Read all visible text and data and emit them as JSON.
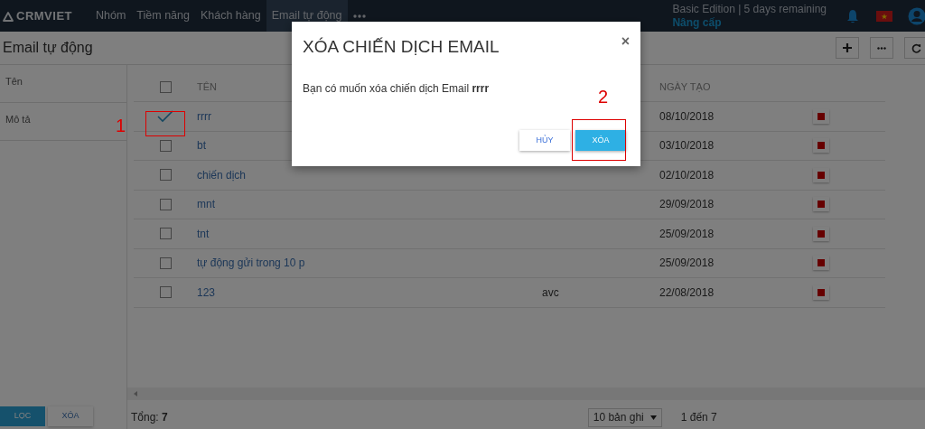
{
  "navbar": {
    "logo": "CRMVIET",
    "menu": [
      {
        "label": "Nhóm",
        "selected": false
      },
      {
        "label": "Tiềm năng",
        "selected": false
      },
      {
        "label": "Khách hàng",
        "selected": false
      },
      {
        "label": "Email tự động",
        "selected": true
      }
    ],
    "edition": "Basic Edition | 5 days remaining",
    "upgrade": "Nâng cấp"
  },
  "page": {
    "title": "Email tự động"
  },
  "filters": [
    {
      "label": "Tên"
    },
    {
      "label": "Mô tả"
    }
  ],
  "filter_buttons": [
    {
      "label": "LỌC",
      "kind": "primary"
    },
    {
      "label": "XÓA",
      "kind": "secondary"
    }
  ],
  "table": {
    "header_checked": false,
    "columns": [
      "TÊN",
      "NGÀY TẠO"
    ],
    "rows": [
      {
        "checked": true,
        "name": "rrrr",
        "created": "08/10/2018"
      },
      {
        "checked": false,
        "name": "bt",
        "created": "03/10/2018"
      },
      {
        "checked": false,
        "name": "chiến dịch",
        "created": "02/10/2018"
      },
      {
        "checked": false,
        "name": "mnt",
        "created": "29/09/2018"
      },
      {
        "checked": false,
        "name": "tnt",
        "created": "25/09/2018"
      },
      {
        "checked": false,
        "name": "tự động gửi trong 10 p",
        "created": "25/09/2018"
      },
      {
        "checked": false,
        "name": "123",
        "description": "avc",
        "created": "22/08/2018"
      }
    ]
  },
  "footer": {
    "total": "Tổng: **7**",
    "page_size": "10 bản ghi",
    "range": "1 đến 7"
  },
  "dialog": {
    "title": "XÓA CHIẾN DỊCH EMAIL",
    "close": "×",
    "message": "Bạn có muốn xóa chiến dịch Email **rrrr**",
    "buttons": [
      {
        "label": "HỦY",
        "kind": "secondary"
      },
      {
        "label": "XÓA",
        "kind": "primary"
      }
    ]
  },
  "annotations": [
    "1",
    "2"
  ]
}
